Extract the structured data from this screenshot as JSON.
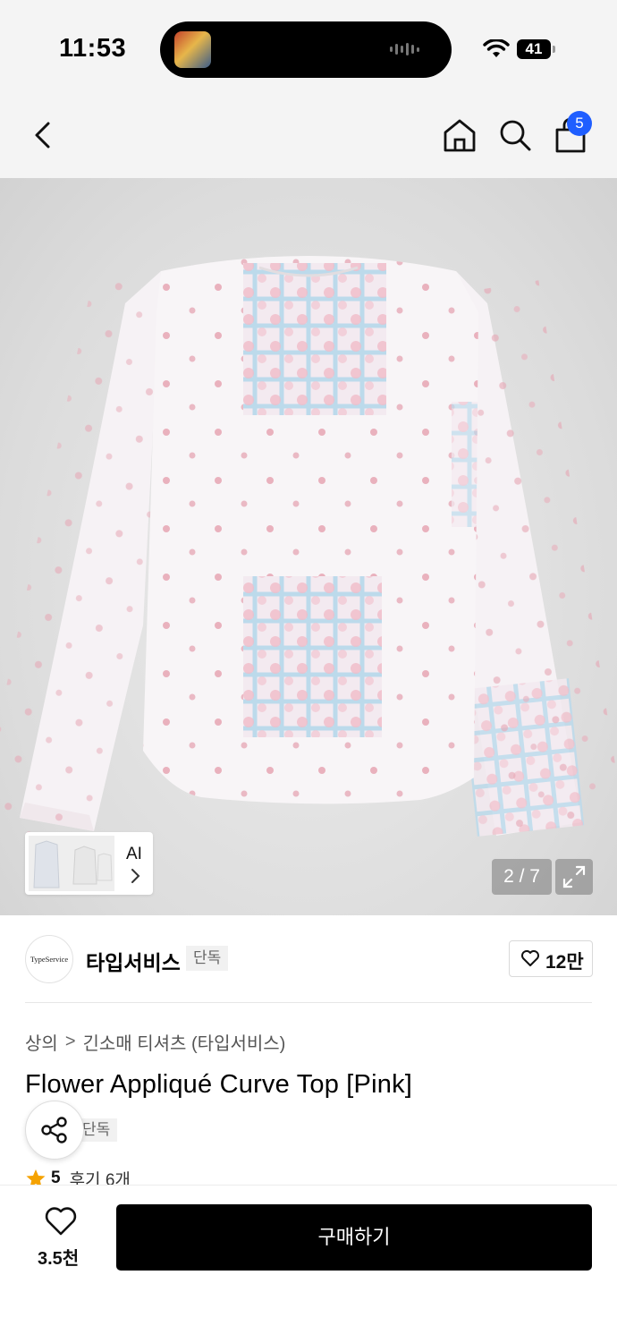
{
  "status_bar": {
    "time": "11:53",
    "battery": "41"
  },
  "header": {
    "cart_count": "5"
  },
  "gallery": {
    "ai_label": "AI",
    "counter": "2 / 7"
  },
  "brand": {
    "logo_text": "TypeService",
    "name": "타입서비스",
    "tag": "단독",
    "like_count": "12만"
  },
  "breadcrumb": {
    "level1": "상의",
    "separator": ">",
    "level2": "긴소매 티셔츠 (타입서비스)"
  },
  "product": {
    "title": "Flower Appliqué Curve Top [Pink]",
    "tag": "단독",
    "rating": "5",
    "review_text": "후기 6개"
  },
  "bottom_bar": {
    "wish_count": "3.5천",
    "buy_label": "구매하기"
  },
  "colors": {
    "badge": "#1f5eff",
    "star": "#f5a200",
    "buy_button": "#000000",
    "shirt_pink": "#e8a6b4",
    "shirt_blue": "#9fcde3"
  },
  "icons": [
    "back-icon",
    "home-icon",
    "search-icon",
    "bag-icon",
    "chevron-right-icon",
    "expand-icon",
    "heart-icon",
    "share-icon",
    "star-icon",
    "wifi-icon"
  ]
}
